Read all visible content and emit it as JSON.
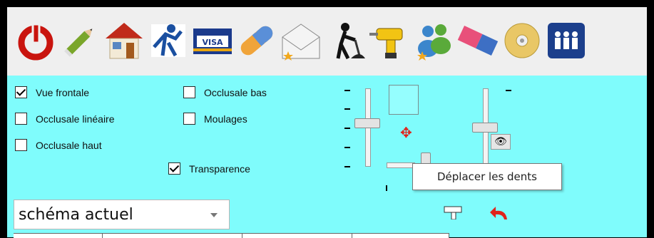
{
  "toolbar": {
    "icons": [
      "power-icon",
      "pencil-icon",
      "home-icon",
      "figure-icon",
      "credit-card-icon",
      "capsule-icon",
      "envelope-icon",
      "construction-worker-icon",
      "drill-icon",
      "users-icon",
      "eraser-icon",
      "cd-icon",
      "group-icon"
    ],
    "card_text": "VISA"
  },
  "options": {
    "vue_frontale": {
      "label": "Vue frontale",
      "checked": true
    },
    "occlusale_lineaire": {
      "label": "Occlusale linéaire",
      "checked": false
    },
    "occlusale_haut": {
      "label": "Occlusale haut",
      "checked": false
    },
    "occlusale_bas": {
      "label": "Occlusale bas",
      "checked": false
    },
    "moulages": {
      "label": "Moulages",
      "checked": false
    },
    "transparence": {
      "label": "Transparence",
      "checked": true
    }
  },
  "tooltip": "Déplacer les dents",
  "schema_select": {
    "value": "schéma actuel"
  },
  "colors": {
    "panel": "#7ffcfc",
    "toolbar": "#efefef",
    "accent": "#e0231b"
  }
}
